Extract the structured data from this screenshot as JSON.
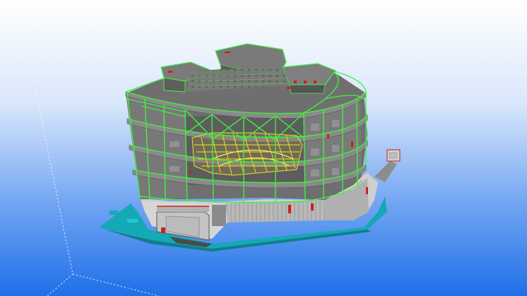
{
  "viewport": {
    "background_top": "#ffffff",
    "background_bottom": "#1f6fe8",
    "bounding_box_color": "#ffffff"
  },
  "model": {
    "structure_color": "#40f040",
    "slab_color": "#6e6e6e",
    "facade_color": "#a9a9a9",
    "podium_color": "#bdbdbd",
    "base_color": "#14a9b5",
    "truss_color": "#f2e02a",
    "accent_color": "#cc1f1f"
  }
}
